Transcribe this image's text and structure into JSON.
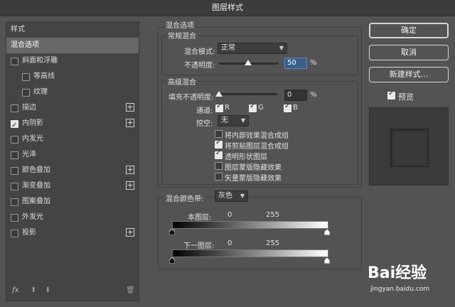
{
  "window": {
    "title": "图层样式"
  },
  "sidebar": {
    "header": "样式",
    "items": [
      {
        "label": "混合选项",
        "checkbox": false,
        "checked": false,
        "plus": false,
        "indent": 0,
        "selected": true
      },
      {
        "label": "斜面和浮雕",
        "checkbox": true,
        "checked": false,
        "plus": false,
        "indent": 0,
        "selected": false
      },
      {
        "label": "等高线",
        "checkbox": true,
        "checked": false,
        "plus": false,
        "indent": 1,
        "selected": false
      },
      {
        "label": "纹理",
        "checkbox": true,
        "checked": false,
        "plus": false,
        "indent": 1,
        "selected": false
      },
      {
        "label": "描边",
        "checkbox": true,
        "checked": false,
        "plus": true,
        "indent": 0,
        "selected": false
      },
      {
        "label": "内阴影",
        "checkbox": true,
        "checked": true,
        "plus": true,
        "indent": 0,
        "selected": false
      },
      {
        "label": "内发光",
        "checkbox": true,
        "checked": false,
        "plus": false,
        "indent": 0,
        "selected": false
      },
      {
        "label": "光泽",
        "checkbox": true,
        "checked": false,
        "plus": false,
        "indent": 0,
        "selected": false
      },
      {
        "label": "颜色叠加",
        "checkbox": true,
        "checked": false,
        "plus": true,
        "indent": 0,
        "selected": false
      },
      {
        "label": "渐变叠加",
        "checkbox": true,
        "checked": false,
        "plus": true,
        "indent": 0,
        "selected": false
      },
      {
        "label": "图案叠加",
        "checkbox": true,
        "checked": false,
        "plus": false,
        "indent": 0,
        "selected": false
      },
      {
        "label": "外发光",
        "checkbox": true,
        "checked": false,
        "plus": false,
        "indent": 0,
        "selected": false
      },
      {
        "label": "投影",
        "checkbox": true,
        "checked": false,
        "plus": true,
        "indent": 0,
        "selected": false
      }
    ],
    "footer": {
      "fx": "fx"
    }
  },
  "blend": {
    "section_title": "混合选项",
    "general_title": "常规混合",
    "mode_label": "混合模式:",
    "mode_value": "正常",
    "opacity_label": "不透明度:",
    "opacity_value": "50",
    "percent": "%",
    "advanced_title": "高级混合",
    "fill_label": "填充不透明度:",
    "fill_value": "0",
    "channels_label": "通道:",
    "channel_r": "R",
    "channel_g": "G",
    "channel_b": "B",
    "knockout_label": "挖空:",
    "knockout_value": "无",
    "options": [
      {
        "label": "将内部效果混合成组",
        "checked": false
      },
      {
        "label": "将剪贴图层混合成组",
        "checked": true
      },
      {
        "label": "透明形状图层",
        "checked": true
      },
      {
        "label": "图层蒙版隐藏效果",
        "checked": false
      },
      {
        "label": "矢量蒙版隐藏效果",
        "checked": false
      }
    ],
    "blend_if_label": "混合颜色带:",
    "blend_if_value": "灰色",
    "this_layer_label": "本图层:",
    "this_layer_min": "0",
    "this_layer_max": "255",
    "underlying_label": "下一图层:",
    "underlying_min": "0",
    "underlying_max": "255"
  },
  "buttons": {
    "ok": "确定",
    "cancel": "取消",
    "new_style": "新建样式...",
    "preview_label": "预览"
  },
  "watermark": {
    "logo": "Bai经验",
    "url": "jingyan.baidu.com"
  }
}
